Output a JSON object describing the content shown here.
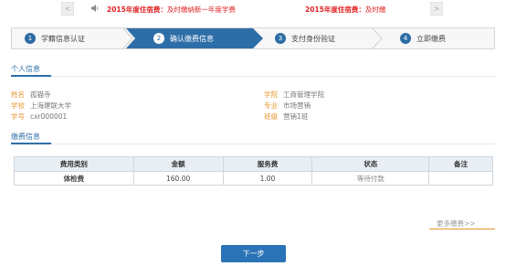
{
  "announcement": {
    "prev_symbol": "<",
    "next_symbol": ">",
    "item1_bold": "2015年度住宿费：",
    "item1_rest": "及时缴纳新一年度学费",
    "item2_bold": "2015年度住宿费：",
    "item2_rest": "及时缴"
  },
  "steps": [
    {
      "num": "1",
      "label": "学籍信息认证"
    },
    {
      "num": "2",
      "label": "确认缴费信息"
    },
    {
      "num": "3",
      "label": "支付身份验证"
    },
    {
      "num": "4",
      "label": "立即缴费"
    }
  ],
  "personal": {
    "title": "个人信息",
    "name_label": "姓名",
    "name_value": "孤猫寺",
    "school_label": "学校",
    "school_value": "上海建联大学",
    "id_label": "学号",
    "id_value": "cxr000001",
    "college_label": "学院",
    "college_value": "工商管理学院",
    "major_label": "专业",
    "major_value": "市场营销",
    "class_label": "班级",
    "class_value": "营销1班"
  },
  "payment": {
    "title": "缴费信息",
    "headers": [
      "费用类别",
      "金额",
      "服务费",
      "状态",
      "备注"
    ],
    "rows": [
      [
        "体检费",
        "160.00",
        "1.00",
        "等待付款",
        ""
      ]
    ]
  },
  "more_link": "更多缴费>>",
  "next_button": "下一步",
  "colors": {
    "accent": "#2e6ea8",
    "label": "#e8962e",
    "alert": "#e02020"
  }
}
